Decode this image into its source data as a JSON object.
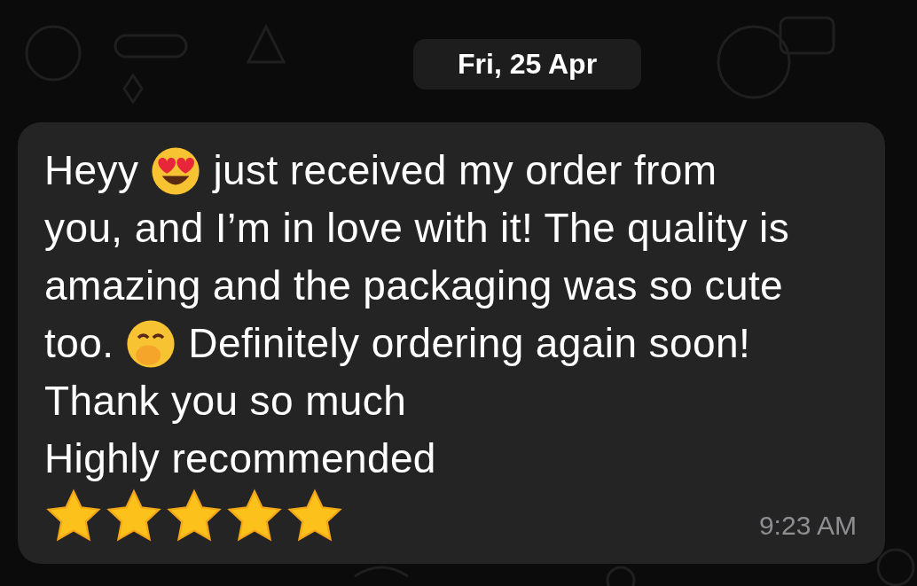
{
  "date_divider": "Fri, 25 Apr",
  "message": {
    "lines": [
      [
        {
          "kind": "text",
          "text": "Heyy"
        },
        {
          "kind": "heart_eyes"
        },
        {
          "kind": "text",
          "text": "just received my order from"
        }
      ],
      [
        {
          "kind": "text",
          "text": "you, and I’m in love with it! The quality is"
        }
      ],
      [
        {
          "kind": "text",
          "text": "amazing and the packaging was so cute"
        }
      ],
      [
        {
          "kind": "text",
          "text": "too."
        },
        {
          "kind": "hand_over_mouth"
        },
        {
          "kind": "text",
          "text": "Definitely ordering again soon!"
        }
      ],
      [
        {
          "kind": "text",
          "text": "Thank you so much"
        }
      ],
      [
        {
          "kind": "text",
          "text": "Highly recommended"
        }
      ]
    ],
    "stars": 5,
    "time": "9:23 AM"
  }
}
